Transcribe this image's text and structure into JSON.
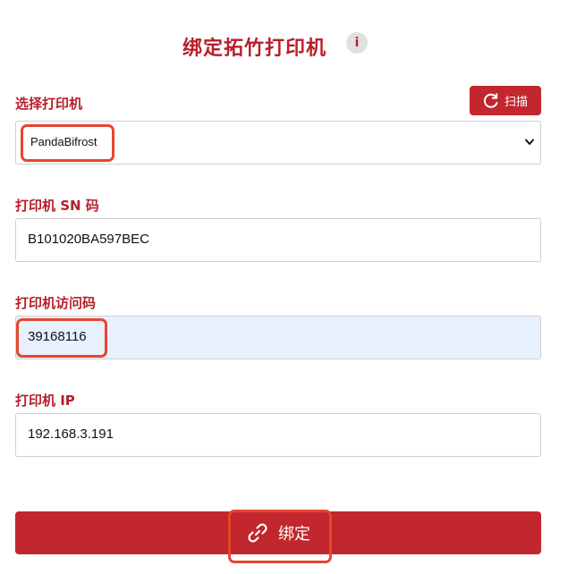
{
  "header": {
    "title": "绑定拓竹打印机",
    "info_icon_glyph": "i"
  },
  "printer_select": {
    "label": "选择打印机",
    "selected": "PandaBifrost",
    "scan_label": "扫描"
  },
  "serial": {
    "label": "打印机 SN 码",
    "value": "B101020BA597BEC"
  },
  "access_code": {
    "label": "打印机访问码",
    "value": "39168116"
  },
  "ip": {
    "label": "打印机 IP",
    "value": "192.168.3.191"
  },
  "bind_button": {
    "label": "绑定"
  },
  "colors": {
    "accent": "#c1272d",
    "label": "#b71f2b",
    "highlight": "#e8452c",
    "autofill": "#e8f0fe"
  }
}
